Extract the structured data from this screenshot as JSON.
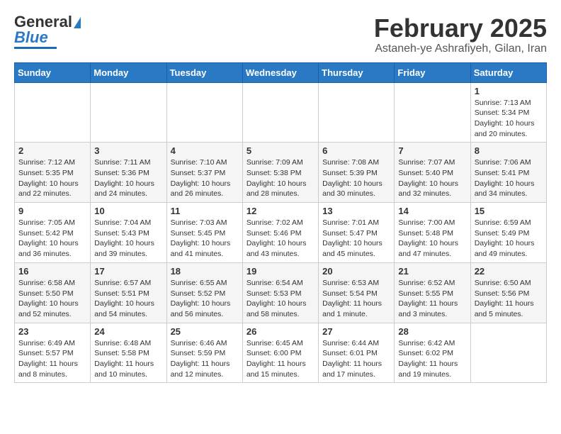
{
  "header": {
    "logo": {
      "line1": "General",
      "line2": "Blue"
    },
    "title": "February 2025",
    "location": "Astaneh-ye Ashrafiyeh, Gilan, Iran"
  },
  "weekdays": [
    "Sunday",
    "Monday",
    "Tuesday",
    "Wednesday",
    "Thursday",
    "Friday",
    "Saturday"
  ],
  "weeks": [
    [
      {
        "day": "",
        "info": ""
      },
      {
        "day": "",
        "info": ""
      },
      {
        "day": "",
        "info": ""
      },
      {
        "day": "",
        "info": ""
      },
      {
        "day": "",
        "info": ""
      },
      {
        "day": "",
        "info": ""
      },
      {
        "day": "1",
        "info": "Sunrise: 7:13 AM\nSunset: 5:34 PM\nDaylight: 10 hours\nand 20 minutes."
      }
    ],
    [
      {
        "day": "2",
        "info": "Sunrise: 7:12 AM\nSunset: 5:35 PM\nDaylight: 10 hours\nand 22 minutes."
      },
      {
        "day": "3",
        "info": "Sunrise: 7:11 AM\nSunset: 5:36 PM\nDaylight: 10 hours\nand 24 minutes."
      },
      {
        "day": "4",
        "info": "Sunrise: 7:10 AM\nSunset: 5:37 PM\nDaylight: 10 hours\nand 26 minutes."
      },
      {
        "day": "5",
        "info": "Sunrise: 7:09 AM\nSunset: 5:38 PM\nDaylight: 10 hours\nand 28 minutes."
      },
      {
        "day": "6",
        "info": "Sunrise: 7:08 AM\nSunset: 5:39 PM\nDaylight: 10 hours\nand 30 minutes."
      },
      {
        "day": "7",
        "info": "Sunrise: 7:07 AM\nSunset: 5:40 PM\nDaylight: 10 hours\nand 32 minutes."
      },
      {
        "day": "8",
        "info": "Sunrise: 7:06 AM\nSunset: 5:41 PM\nDaylight: 10 hours\nand 34 minutes."
      }
    ],
    [
      {
        "day": "9",
        "info": "Sunrise: 7:05 AM\nSunset: 5:42 PM\nDaylight: 10 hours\nand 36 minutes."
      },
      {
        "day": "10",
        "info": "Sunrise: 7:04 AM\nSunset: 5:43 PM\nDaylight: 10 hours\nand 39 minutes."
      },
      {
        "day": "11",
        "info": "Sunrise: 7:03 AM\nSunset: 5:45 PM\nDaylight: 10 hours\nand 41 minutes."
      },
      {
        "day": "12",
        "info": "Sunrise: 7:02 AM\nSunset: 5:46 PM\nDaylight: 10 hours\nand 43 minutes."
      },
      {
        "day": "13",
        "info": "Sunrise: 7:01 AM\nSunset: 5:47 PM\nDaylight: 10 hours\nand 45 minutes."
      },
      {
        "day": "14",
        "info": "Sunrise: 7:00 AM\nSunset: 5:48 PM\nDaylight: 10 hours\nand 47 minutes."
      },
      {
        "day": "15",
        "info": "Sunrise: 6:59 AM\nSunset: 5:49 PM\nDaylight: 10 hours\nand 49 minutes."
      }
    ],
    [
      {
        "day": "16",
        "info": "Sunrise: 6:58 AM\nSunset: 5:50 PM\nDaylight: 10 hours\nand 52 minutes."
      },
      {
        "day": "17",
        "info": "Sunrise: 6:57 AM\nSunset: 5:51 PM\nDaylight: 10 hours\nand 54 minutes."
      },
      {
        "day": "18",
        "info": "Sunrise: 6:55 AM\nSunset: 5:52 PM\nDaylight: 10 hours\nand 56 minutes."
      },
      {
        "day": "19",
        "info": "Sunrise: 6:54 AM\nSunset: 5:53 PM\nDaylight: 10 hours\nand 58 minutes."
      },
      {
        "day": "20",
        "info": "Sunrise: 6:53 AM\nSunset: 5:54 PM\nDaylight: 11 hours\nand 1 minute."
      },
      {
        "day": "21",
        "info": "Sunrise: 6:52 AM\nSunset: 5:55 PM\nDaylight: 11 hours\nand 3 minutes."
      },
      {
        "day": "22",
        "info": "Sunrise: 6:50 AM\nSunset: 5:56 PM\nDaylight: 11 hours\nand 5 minutes."
      }
    ],
    [
      {
        "day": "23",
        "info": "Sunrise: 6:49 AM\nSunset: 5:57 PM\nDaylight: 11 hours\nand 8 minutes."
      },
      {
        "day": "24",
        "info": "Sunrise: 6:48 AM\nSunset: 5:58 PM\nDaylight: 11 hours\nand 10 minutes."
      },
      {
        "day": "25",
        "info": "Sunrise: 6:46 AM\nSunset: 5:59 PM\nDaylight: 11 hours\nand 12 minutes."
      },
      {
        "day": "26",
        "info": "Sunrise: 6:45 AM\nSunset: 6:00 PM\nDaylight: 11 hours\nand 15 minutes."
      },
      {
        "day": "27",
        "info": "Sunrise: 6:44 AM\nSunset: 6:01 PM\nDaylight: 11 hours\nand 17 minutes."
      },
      {
        "day": "28",
        "info": "Sunrise: 6:42 AM\nSunset: 6:02 PM\nDaylight: 11 hours\nand 19 minutes."
      },
      {
        "day": "",
        "info": ""
      }
    ]
  ]
}
